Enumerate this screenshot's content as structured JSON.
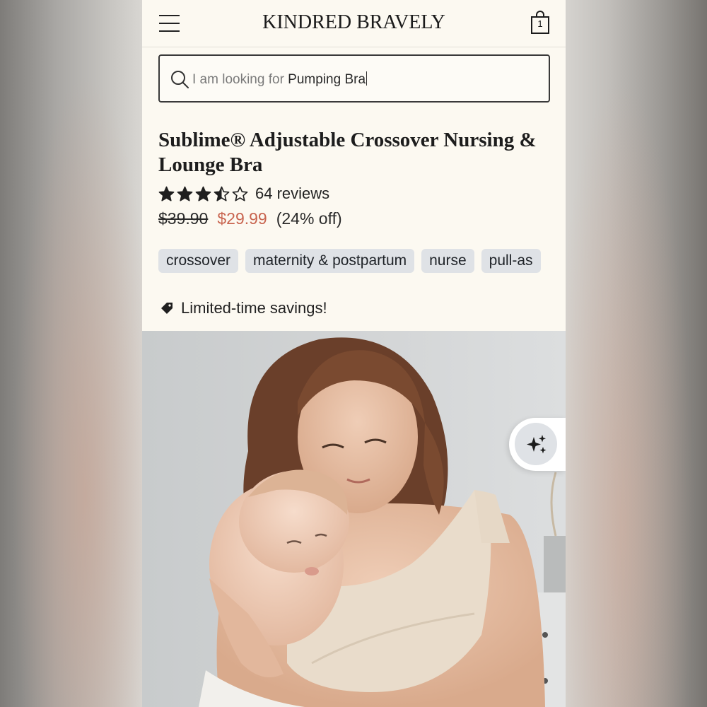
{
  "brand": {
    "logo_text": "KINDRED BRAVELY"
  },
  "header": {
    "cart_count": "1"
  },
  "search": {
    "prefix": "I am looking for ",
    "value": "Pumping Bra"
  },
  "product": {
    "title": "Sublime® Adjustable Crossover Nursing & Lounge Bra",
    "rating": 3.5,
    "rating_max": 5,
    "reviews_label": "64 reviews",
    "original_price": "$39.90",
    "sale_price": "$29.99",
    "discount_label": "(24% off)",
    "tags": [
      "crossover",
      "maternity & postpartum",
      "nurse",
      "pull-as"
    ],
    "promo_text": "Limited-time savings!"
  },
  "colors": {
    "page_bg": "#fcf9f1",
    "sale_price": "#c8644f",
    "tag_bg": "#dfe2e6",
    "text": "#1d1d1d"
  },
  "icons": {
    "menu": "hamburger-icon",
    "cart": "shopping-bag-icon",
    "search": "search-icon",
    "promo": "price-tag-icon",
    "ai": "sparkle-icon"
  }
}
